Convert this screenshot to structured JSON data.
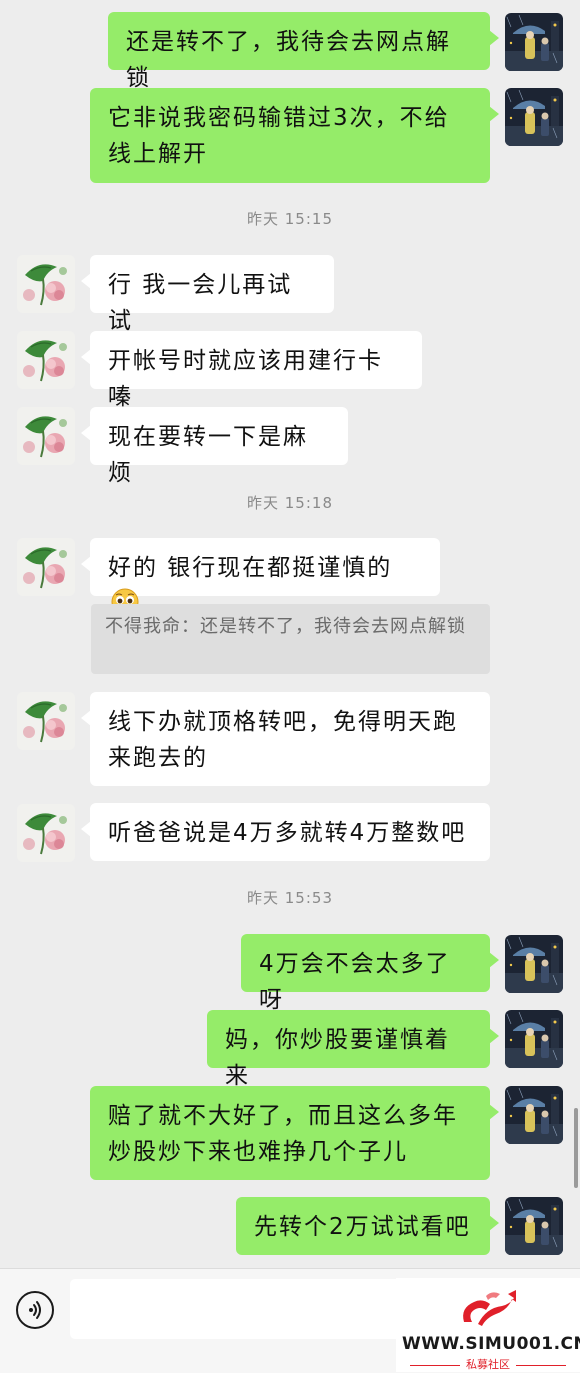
{
  "colors": {
    "background": "#ededed",
    "outgoing_bubble": "#95ec69",
    "incoming_bubble": "#ffffff",
    "quote_background": "#dedede",
    "timestamp_text": "#8a8a8a"
  },
  "messages": [
    {
      "direction": "outgoing",
      "text": "还是转不了，我待会去网点解锁"
    },
    {
      "direction": "outgoing",
      "text": "它非说我密码输错过3次，不给线上解开"
    },
    {
      "direction": "incoming",
      "text": "行 我一会儿再试试"
    },
    {
      "direction": "incoming",
      "text": "开帐号时就应该用建行卡嗪"
    },
    {
      "direction": "incoming",
      "text": "现在要转一下是麻烦"
    },
    {
      "direction": "incoming",
      "text": "好的 银行现在都挺谨慎的",
      "emoji": "pleading-face-emoji"
    },
    {
      "direction": "incoming",
      "text": "线下办就顶格转吧，免得明天跑来跑去的"
    },
    {
      "direction": "incoming",
      "text": "听爸爸说是4万多就转4万整数吧"
    },
    {
      "direction": "outgoing",
      "text": "4万会不会太多了呀"
    },
    {
      "direction": "outgoing",
      "text": "妈，你炒股要谨慎着来"
    },
    {
      "direction": "outgoing",
      "text": "赔了就不大好了，而且这么多年炒股炒下来也难挣几个子儿"
    },
    {
      "direction": "outgoing",
      "text": "先转个2万试试看吧"
    }
  ],
  "timestamps": [
    "昨天 15:15",
    "昨天 15:18",
    "昨天 15:53"
  ],
  "quote": {
    "sender": "不得我命",
    "separator": "：",
    "text": "还是转不了，我待会去网点解锁"
  },
  "avatars": {
    "self": "night-rain-figure-avatar",
    "other": "lotus-leaf-avatar"
  },
  "bottom_bar": {
    "voice_icon": "voice-input-icon",
    "input_value": ""
  },
  "watermark": {
    "site": "WWW.SIMU001.CN",
    "subtitle": "私募社区"
  }
}
